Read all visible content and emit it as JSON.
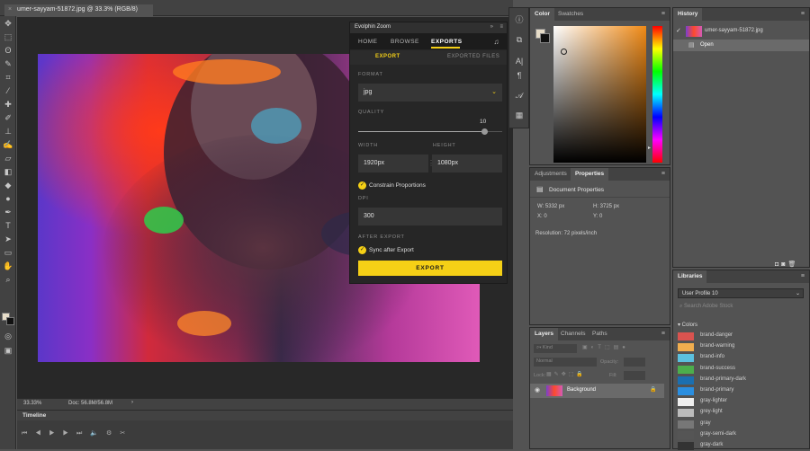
{
  "document_tab": {
    "title": "umer-sayyam-51872.jpg @ 33.3% (RGB/8)",
    "close": "×"
  },
  "status": {
    "zoom": "33.33%",
    "doc": "Doc: 56.8M/56.8M",
    "arrow": "›"
  },
  "timeline": {
    "title": "Timeline"
  },
  "evolphin": {
    "title": "Evolphin Zoom",
    "nav": {
      "home": "HOME",
      "browse": "BROWSE",
      "exports": "EXPORTS"
    },
    "subtabs": {
      "export": "EXPORT",
      "exported": "EXPORTED FILES"
    },
    "format_label": "FORMAT",
    "format_value": "jpg",
    "quality_label": "QUALITY",
    "quality_value": "10",
    "quality_fraction": 1.0,
    "width_label": "WIDTH",
    "height_label": "HEIGHT",
    "width_value": "1920px",
    "height_value": "1080px",
    "constrain_label": "Constrain Proportions",
    "dpi_label": "DPI",
    "dpi_value": "300",
    "after_label": "AFTER EXPORT",
    "sync_label": "Sync after Export",
    "export_button": "EXPORT"
  },
  "color_panel": {
    "tab_color": "Color",
    "tab_swatches": "Swatches"
  },
  "history_panel": {
    "title": "History",
    "snapshot": "umer-sayyam-51872.jpg",
    "step": "Open"
  },
  "properties_panel": {
    "tab_adjust": "Adjustments",
    "tab_props": "Properties",
    "heading": "Document Properties",
    "w": "W:  5332 px",
    "h": "H:  3725 px",
    "x": "X:  0",
    "y": "Y:  0",
    "resolution": "Resolution: 72 pixels/inch"
  },
  "libraries_panel": {
    "title": "Libraries",
    "profile": "User Profile 10",
    "search_placeholder": "Search Adobe Stock",
    "colors_heading": "▾ Colors",
    "colors": [
      {
        "name": "brand-danger",
        "color": "#d9534f"
      },
      {
        "name": "brand-warning",
        "color": "#f0ad4e"
      },
      {
        "name": "brand-info",
        "color": "#5bc0de"
      },
      {
        "name": "brand-success",
        "color": "#4cae4c"
      },
      {
        "name": "brand-primary-dark",
        "color": "#1b6fb0"
      },
      {
        "name": "brand-primary",
        "color": "#2a8ee0"
      },
      {
        "name": "gray-lighter",
        "color": "#eeeeee"
      },
      {
        "name": "grey-light",
        "color": "#bbbbbb"
      },
      {
        "name": "gray",
        "color": "#777777"
      },
      {
        "name": "gray-semi-dark",
        "color": "#555555"
      },
      {
        "name": "gray-dark",
        "color": "#333333"
      }
    ]
  },
  "layers_panel": {
    "tab_layers": "Layers",
    "tab_channels": "Channels",
    "tab_paths": "Paths",
    "kind": "Kind",
    "blend": "Normal",
    "opacity_label": "Opacity:",
    "lock_label": "Lock:",
    "fill_label": "Fill:",
    "layer_name": "Background"
  }
}
